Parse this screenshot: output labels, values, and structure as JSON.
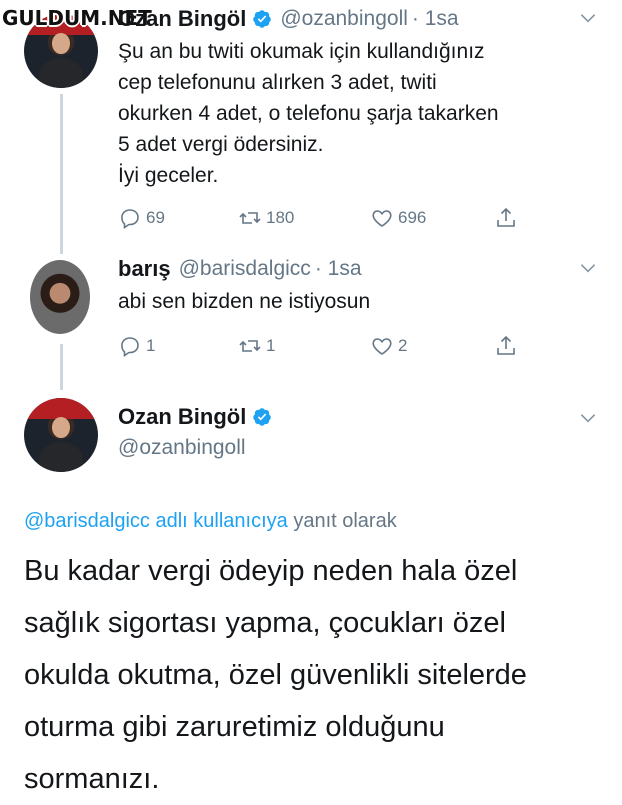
{
  "watermark": "GULDUM.NET",
  "tweet1": {
    "name": "Ozan Bingöl",
    "handle": "@ozanbingoll",
    "time": "· 1sa",
    "text": "Şu an bu twiti okumak için kullandığınız\ncep telefonunu alırken 3 adet, twiti\nokurken 4 adet, o telefonu şarja takarken\n5 adet vergi ödersiniz.\nİyi geceler.",
    "replies": "69",
    "retweets": "180",
    "likes": "696"
  },
  "tweet2": {
    "name": "barış",
    "handle": "@barisdalgicc",
    "time": "· 1sa",
    "text": "abi sen bizden ne istiyosun",
    "replies": "1",
    "retweets": "1",
    "likes": "2"
  },
  "tweet3": {
    "name": "Ozan Bingöl",
    "handle": "@ozanbingoll",
    "reply_to_link": "@barisdalgicc adlı kullanıcıya",
    "reply_to_suffix": " yanıt olarak",
    "text": "Bu kadar vergi ödeyip neden hala özel\nsağlık sigortası yapma, çocukları özel\nokulda okutma, özel güvenlikli sitelerde\noturma gibi zaruretimiz olduğunu\nsormanızı."
  },
  "icons": {
    "reply": "reply-icon",
    "retweet": "retweet-icon",
    "like": "heart-icon",
    "share": "share-icon",
    "verified": "verified-badge-icon",
    "more": "chevron-down-icon"
  },
  "colors": {
    "verified": "#1da1f2",
    "secondary_text": "#657786",
    "link": "#1da1f2",
    "thread_line": "#ccd6dd"
  }
}
